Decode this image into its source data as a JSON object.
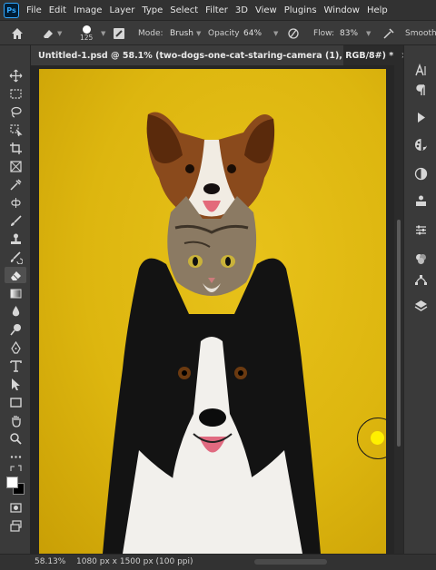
{
  "menu": {
    "logo": "Ps",
    "items": [
      "File",
      "Edit",
      "Image",
      "Layer",
      "Type",
      "Select",
      "Filter",
      "3D",
      "View",
      "Plugins",
      "Window",
      "Help"
    ]
  },
  "options": {
    "brush_size": "125",
    "mode_label": "Mode:",
    "mode_value": "Brush",
    "opacity_label": "Opacity:",
    "opacity_value": "64%",
    "flow_label": "Flow:",
    "flow_value": "83%",
    "smoothing_label": "Smoothi"
  },
  "document": {
    "tab_title": "Untitled-1.psd @ 58.1% (two-dogs-one-cat-staring-camera (1), RGB/8#) *",
    "close_glyph": "×"
  },
  "status": {
    "zoom": "58.13%",
    "info": "1080 px x 1500 px (100 ppi)"
  },
  "colors": {
    "canvas_bg": "#ddb60f",
    "brush_dot": "#fff000",
    "accent": "#31a8ff"
  },
  "icons": {
    "left_tools": [
      "move-icon",
      "marquee-icon",
      "lasso-icon",
      "object-select-icon",
      "crop-icon",
      "frame-icon",
      "eyedropper-icon",
      "healing-icon",
      "brush-icon",
      "stamp-icon",
      "history-brush-icon",
      "eraser-icon",
      "gradient-icon",
      "blur-icon",
      "dodge-icon",
      "pen-icon",
      "type-icon",
      "path-select-icon",
      "rectangle-icon",
      "hand-icon",
      "zoom-icon",
      "more-icon"
    ],
    "right_tools": [
      "character-icon",
      "paragraph-icon",
      "actions-icon",
      "color-icon",
      "adjustments-icon",
      "libraries-icon",
      "properties-icon",
      "channels-icon",
      "paths-icon",
      "layers-icon"
    ]
  }
}
